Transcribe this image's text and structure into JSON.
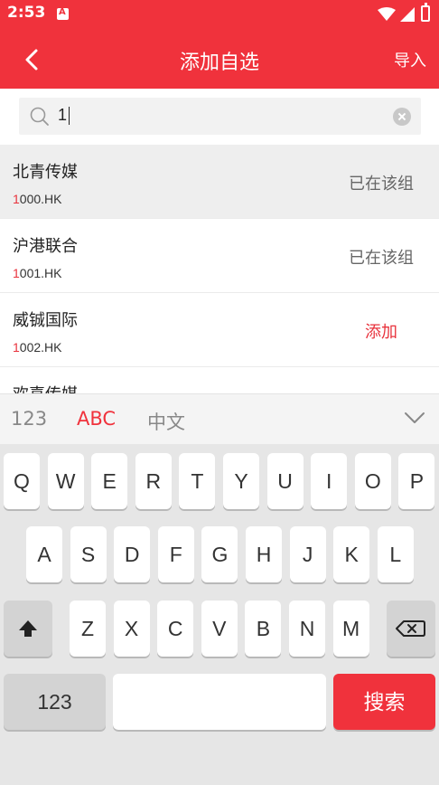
{
  "status_bar": {
    "time": "2:53"
  },
  "header": {
    "back_icon": "back-chevron-icon",
    "title": "添加自选",
    "import_label": "导入"
  },
  "search": {
    "value": "1"
  },
  "results": [
    {
      "name": "北青传媒",
      "code_match": "1",
      "code_rest": "000.HK",
      "status": "已在该组"
    },
    {
      "name": "沪港联合",
      "code_match": "1",
      "code_rest": "001.HK",
      "status": "已在该组"
    },
    {
      "name": "威铖国际",
      "code_match": "1",
      "code_rest": "002.HK",
      "status": "添加"
    },
    {
      "name": "欢喜传媒",
      "code_match": "",
      "code_rest": "",
      "status": ""
    }
  ],
  "keyboard_bar": {
    "modes": [
      "123",
      "ABC",
      "中文"
    ],
    "active_mode": "ABC"
  },
  "keyboard": {
    "row1": [
      "Q",
      "W",
      "E",
      "R",
      "T",
      "Y",
      "U",
      "I",
      "O",
      "P"
    ],
    "row2": [
      "A",
      "S",
      "D",
      "F",
      "G",
      "H",
      "J",
      "K",
      "L"
    ],
    "row3": [
      "Z",
      "X",
      "C",
      "V",
      "B",
      "N",
      "M"
    ],
    "numbers_key": "123",
    "search_key": "搜索"
  },
  "colors": {
    "brand_red": "#f0323c",
    "muted_text": "#666666"
  }
}
